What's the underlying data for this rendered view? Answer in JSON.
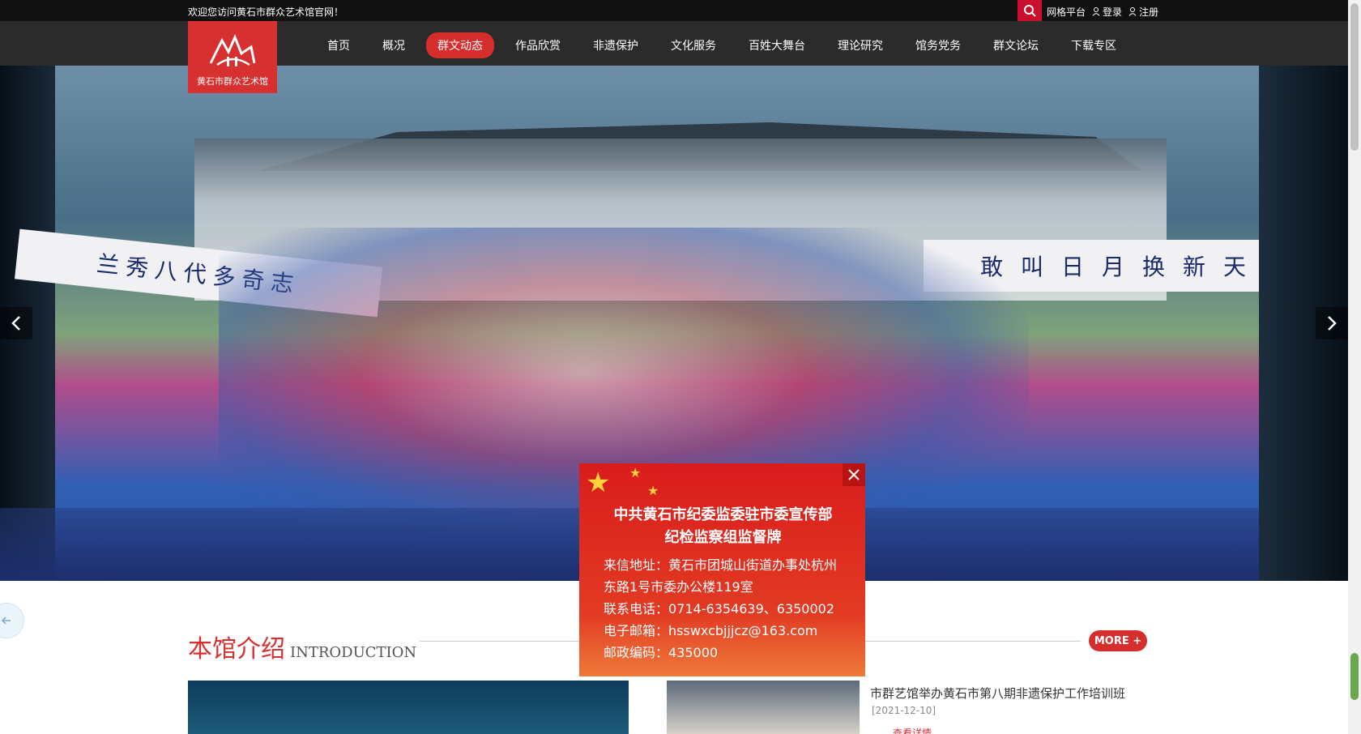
{
  "topbar": {
    "welcome": "欢迎您访问黄石市群众艺术馆官网！",
    "links": [
      "网格平台",
      "登录",
      "注册"
    ]
  },
  "logo": {
    "text": "黄石市群众艺术馆"
  },
  "nav": {
    "items": [
      "首页",
      "概况",
      "群文动态",
      "作品欣赏",
      "非遗保护",
      "文化服务",
      "百姓大舞台",
      "理论研究",
      "馆务党务",
      "群文论坛",
      "下载专区"
    ],
    "active": "群文动态"
  },
  "hero": {
    "banner_left": "兰秀八代多奇志",
    "banner_right": "敢叫日月换新天"
  },
  "section": {
    "title_cn": "本馆介绍",
    "title_en": "INTRODUCTION",
    "more": "MORE +"
  },
  "news": {
    "title": "市群艺馆举办黄石市第八期非遗保护工作培训班",
    "date": "[2021-12-10]",
    "link": "查看详情"
  },
  "popup": {
    "title_line1": "中共黄石市纪委监委驻市委宣传部",
    "title_line2": "纪检监察组监督牌",
    "address_label": "来信地址：",
    "address": "黄石市团城山街道办事处杭州东路1号市委办公楼119室",
    "phone_label": "联系电话：",
    "phone": "0714-6354639、6350002",
    "email_label": "电子邮箱：",
    "email": "hsswxcbjjjcz@163.com",
    "postcode_label": "邮政编码：",
    "postcode": "435000"
  },
  "colors": {
    "accent": "#d62d2d",
    "nav_bg": "#2b2b2b",
    "topbar_bg": "#111111"
  },
  "icons": [
    "search-icon",
    "user-icon",
    "chevron-left-icon",
    "chevron-right-icon",
    "close-icon",
    "star-icon"
  ]
}
